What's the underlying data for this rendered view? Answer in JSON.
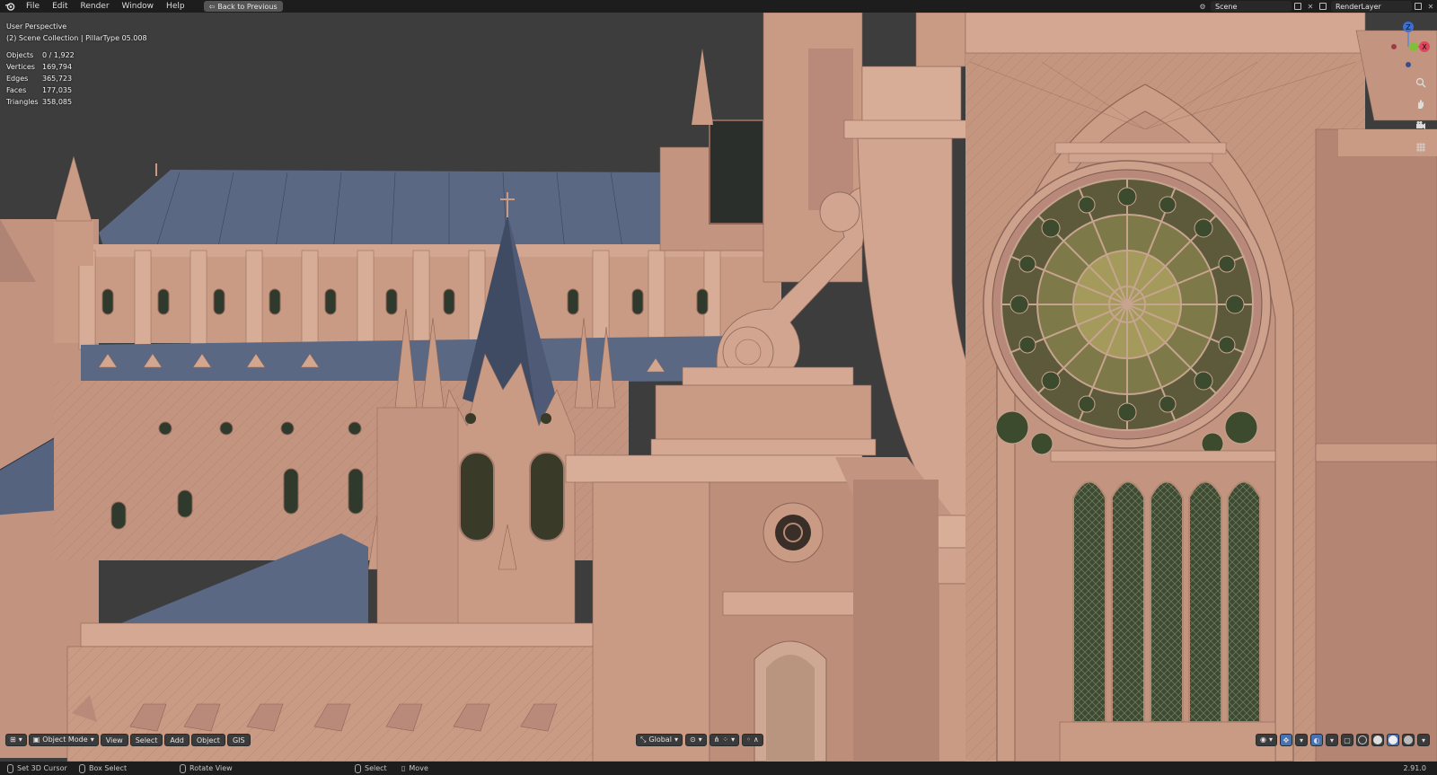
{
  "topbar": {
    "menu": [
      "File",
      "Edit",
      "Render",
      "Window",
      "Help"
    ],
    "back_button": "Back to Previous",
    "scene": "Scene",
    "render_layer": "RenderLayer"
  },
  "viewport": {
    "perspective": "User Perspective",
    "collection": "(2) Scene Collection | PillarType 05.008",
    "stats": [
      {
        "label": "Objects",
        "value": "0 / 1,922"
      },
      {
        "label": "Vertices",
        "value": "169,794"
      },
      {
        "label": "Edges",
        "value": "365,723"
      },
      {
        "label": "Faces",
        "value": "177,035"
      },
      {
        "label": "Triangles",
        "value": "358,085"
      }
    ],
    "gizmo": {
      "x": "X",
      "y": "Y",
      "z": "Z"
    }
  },
  "header": {
    "mode": "Object Mode",
    "menus": [
      "View",
      "Select",
      "Add",
      "Object",
      "GIS"
    ],
    "transform_orientation": "Global"
  },
  "statusbar": {
    "items": [
      {
        "label": "Set 3D Cursor",
        "icon": "mouse-left-icon"
      },
      {
        "label": "Box Select",
        "icon": "mouse-drag-icon"
      },
      {
        "label": "Rotate View",
        "icon": "mouse-middle-icon"
      },
      {
        "label": "Select",
        "icon": "mouse-right-icon"
      },
      {
        "label": "Move",
        "icon": "move-icon"
      }
    ],
    "version": "2.91.0"
  },
  "colors": {
    "stone": "#c99a84",
    "roof": "#55637e",
    "glass_green": "#4a5a3a",
    "accent_blue": "#4772b3"
  }
}
